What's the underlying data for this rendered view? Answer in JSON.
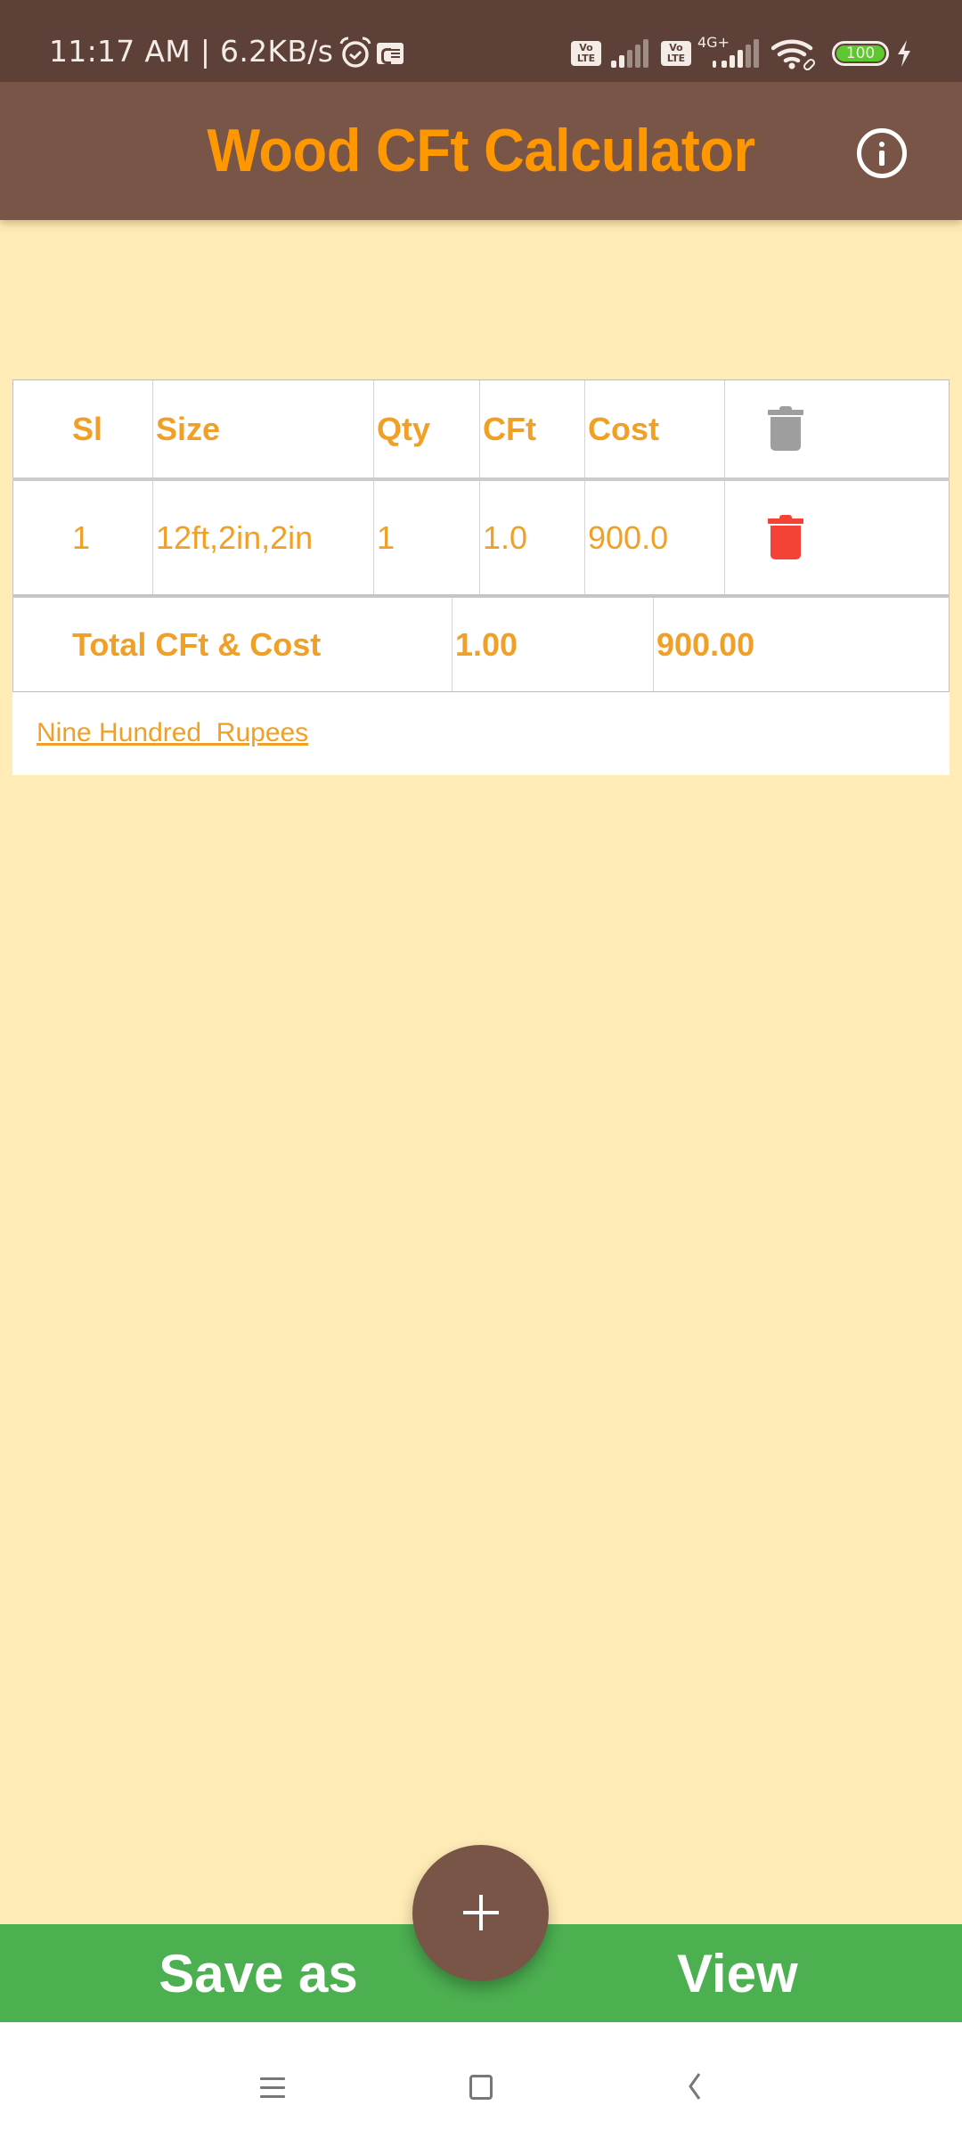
{
  "status_bar": {
    "time_speed": "11:17 AM | 6.2KB/s",
    "volte_label": "Vo\nLTE",
    "network_type": "4G+",
    "battery_level": "100",
    "icons": [
      "alarm-icon",
      "news-icon",
      "volte-icon",
      "signal-icon",
      "volte-icon",
      "4g-signal-icon",
      "wifi-icon",
      "battery-icon",
      "charging-icon"
    ]
  },
  "app_bar": {
    "title": "Wood CFt Calculator",
    "info_icon": "info-icon"
  },
  "table": {
    "headers": {
      "sl": "Sl",
      "size": "Size",
      "qty": "Qty",
      "cft": "CFt",
      "cost": "Cost",
      "delete_all_icon": "trash-icon"
    },
    "rows": [
      {
        "sl": "1",
        "size": "12ft,2in,2in",
        "qty": "1",
        "cft": "1.0",
        "cost": "900.0",
        "delete_icon": "trash-icon"
      }
    ],
    "total": {
      "label": "Total CFt & Cost",
      "cft": "1.00",
      "cost": "900.00"
    },
    "amount_in_words": "Nine Hundred  Rupees"
  },
  "bottom_bar": {
    "save_label": "Save as",
    "view_label": "View",
    "fab_icon": "plus-icon"
  },
  "nav_bar": {
    "icons": [
      "menu-icon",
      "home-icon",
      "back-icon"
    ]
  },
  "colors": {
    "status_bar_bg": "#5D4037",
    "app_bar_bg": "#795548",
    "title_orange": "#FF9800",
    "table_text": "#F0A027",
    "page_bg": "#FEEBB5",
    "bottom_bar_green": "#4CAF50",
    "delete_red": "#F44336",
    "delete_gray": "#9E9E9E"
  }
}
